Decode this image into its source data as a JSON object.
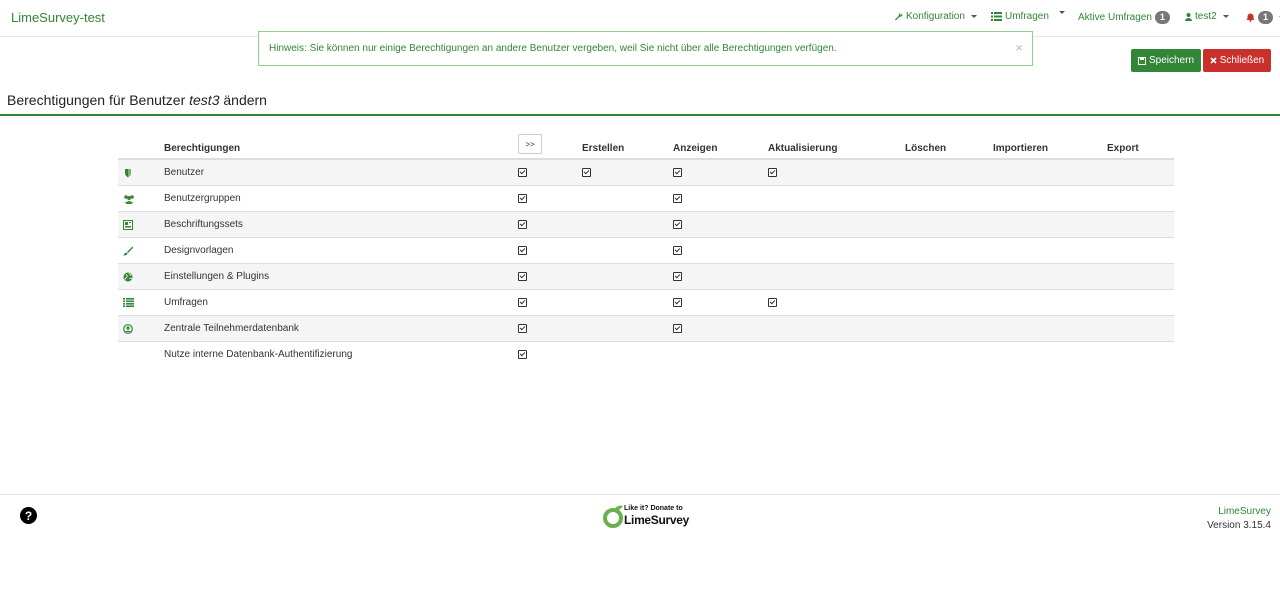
{
  "navbar": {
    "brand": "LimeSurvey-test",
    "konfiguration": "Konfiguration",
    "umfragen": "Umfragen",
    "aktive_umfragen": "Aktive Umfragen",
    "aktive_count": "1",
    "user": "test2",
    "notifications_count": "1"
  },
  "alert": {
    "text": "Hinweis: Sie können nur einige Berechtigungen an andere Benutzer vergeben, weil Sie nicht über alle Berechtigungen verfügen.",
    "close": "×"
  },
  "actions": {
    "save": "Speichern",
    "close": "Schließen"
  },
  "page": {
    "title_prefix": "Berechtigungen für Benutzer",
    "username": "test3",
    "title_suffix": "ändern"
  },
  "table": {
    "headers": {
      "permission": "Berechtigungen",
      "toggle": ">>",
      "create": "Erstellen",
      "read": "Anzeigen",
      "update": "Aktualisierung",
      "delete": "Löschen",
      "import": "Importieren",
      "export": "Export"
    },
    "rows": [
      {
        "label": "Benutzer",
        "icon": "shield-icon",
        "all": true,
        "create": true,
        "read": true,
        "update": true
      },
      {
        "label": "Benutzergruppen",
        "icon": "users-icon",
        "all": true,
        "create": false,
        "read": true,
        "update": false
      },
      {
        "label": "Beschriftungssets",
        "icon": "label-set-icon",
        "all": true,
        "create": false,
        "read": true,
        "update": false
      },
      {
        "label": "Designvorlagen",
        "icon": "paintbrush-icon",
        "all": true,
        "create": false,
        "read": true,
        "update": false
      },
      {
        "label": "Einstellungen & Plugins",
        "icon": "globe-icon",
        "all": true,
        "create": false,
        "read": true,
        "update": false
      },
      {
        "label": "Umfragen",
        "icon": "list-icon",
        "all": true,
        "create": false,
        "read": true,
        "update": true
      },
      {
        "label": "Zentrale Teilnehmerdatenbank",
        "icon": "user-circle-icon",
        "all": true,
        "create": false,
        "read": true,
        "update": false
      },
      {
        "label": "Nutze interne Datenbank-Authentifizierung",
        "icon": "",
        "all": true,
        "create": false,
        "read": false,
        "update": false
      }
    ]
  },
  "footer": {
    "help": "?",
    "donate_top": "Like it? Donate to",
    "donate_bottom": "LimeSurvey",
    "link": "LimeSurvey",
    "version": "Version 3.15.4"
  },
  "colors": {
    "brand_green": "#328637",
    "danger_red": "#c9302c"
  }
}
